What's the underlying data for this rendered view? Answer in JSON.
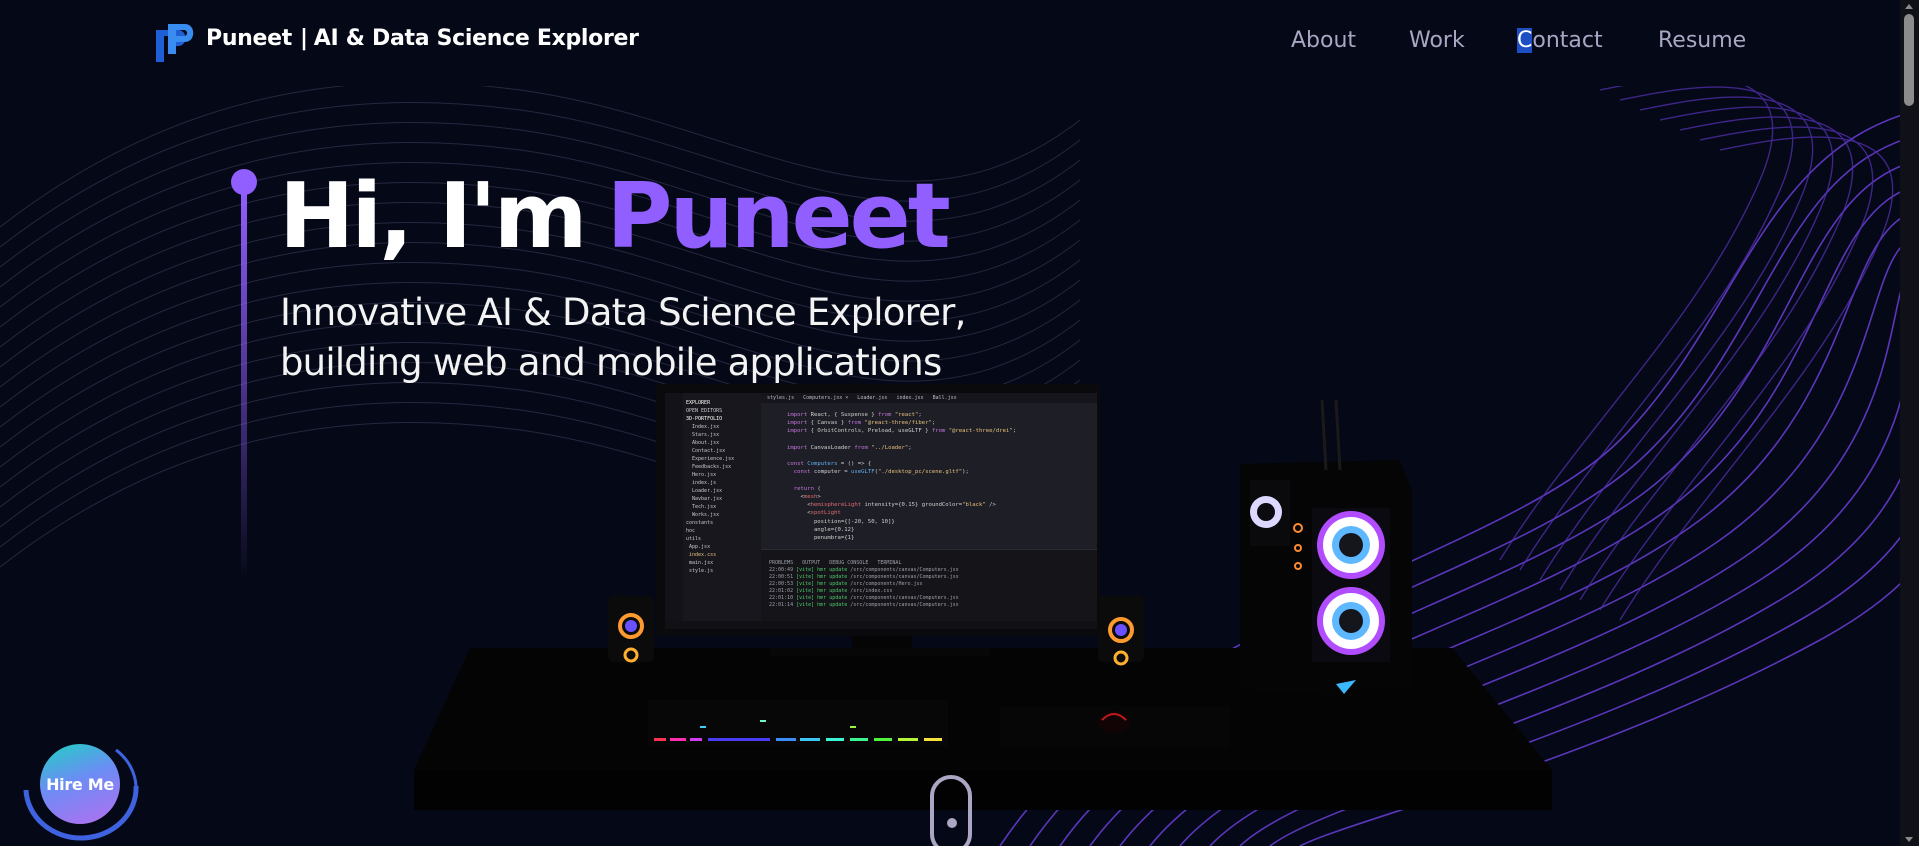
{
  "nav": {
    "brand_name": "Puneet",
    "brand_separator": "|",
    "brand_tagline": "AI & Data Science Explorer",
    "links": {
      "about": "About",
      "work": "Work",
      "contact_first": "C",
      "contact_rest": "ontact",
      "resume": "Resume"
    }
  },
  "hero": {
    "greeting": "Hi, I'm",
    "name": "Puneet",
    "subtitle_line1": "Innovative AI & Data Science Explorer,",
    "subtitle_line2": "building web and mobile applications"
  },
  "hire_button": {
    "label": "Hire Me"
  },
  "icons": {
    "logo": "p-monogram-logo",
    "scroll": "mouse-scroll-icon"
  },
  "colors": {
    "background": "#050816",
    "accent": "#915eff",
    "nav_text": "#aaa6c3"
  }
}
